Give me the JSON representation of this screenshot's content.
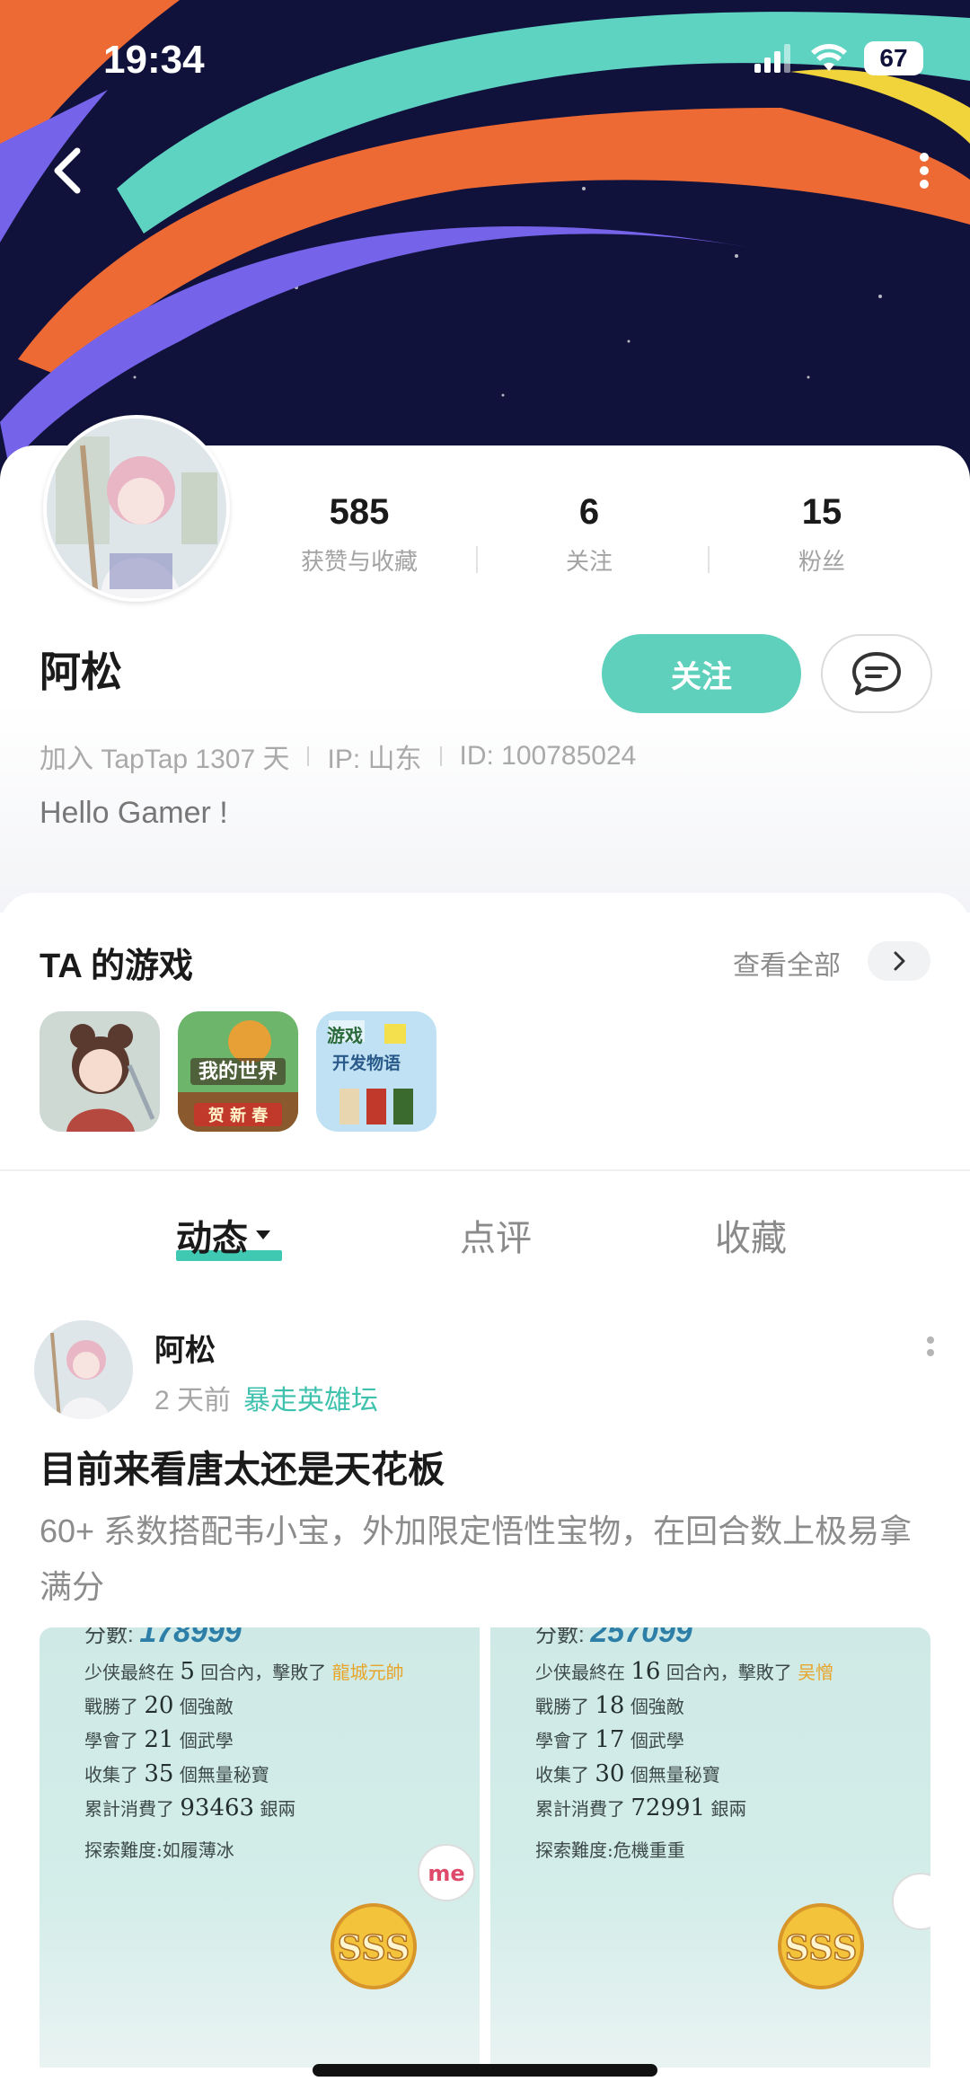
{
  "status_bar": {
    "time": "19:34",
    "battery": "67"
  },
  "profile": {
    "stats": [
      {
        "value": "585",
        "label": "获赞与收藏"
      },
      {
        "value": "6",
        "label": "关注"
      },
      {
        "value": "15",
        "label": "粉丝"
      }
    ],
    "name": "阿松",
    "follow_label": "关注",
    "meta": {
      "joined": "加入 TapTap 1307 天",
      "ip": "IP: 山东",
      "id": "ID: 100785024"
    },
    "bio": "Hello Gamer !"
  },
  "games": {
    "title": "TA 的游戏",
    "see_all": "查看全部",
    "items": [
      {
        "name": "game-1",
        "text": ""
      },
      {
        "name": "game-2",
        "text": "我的世界 贺新春"
      },
      {
        "name": "game-3",
        "text": "游戏 开发物语"
      }
    ]
  },
  "tabs": [
    {
      "label": "动态",
      "active": true
    },
    {
      "label": "点评",
      "active": false
    },
    {
      "label": "收藏",
      "active": false
    }
  ],
  "post": {
    "author": "阿松",
    "time": "2 天前",
    "forum": "暴走英雄坛",
    "title": "目前来看唐太还是天花板",
    "body": "60+ 系数搭配韦小宝，外加限定悟性宝物，在回合数上极易拿满分",
    "images": [
      {
        "score_label": "分數:",
        "score": "178999",
        "rounds": "5",
        "boss": "龍城元帥",
        "wins": "20",
        "skills": "21",
        "treasures": "35",
        "spent": "93463",
        "difficulty": "探索難度:如履薄冰",
        "grade": "SSS"
      },
      {
        "score_label": "分數:",
        "score": "257099",
        "rounds": "16",
        "boss": "吴憎",
        "wins": "18",
        "skills": "17",
        "treasures": "30",
        "spent": "72991",
        "difficulty": "探索難度:危機重重",
        "grade": "SSS"
      }
    ],
    "line_labels": {
      "rounds_pre": "少侠最終在",
      "rounds_post": "回合內，擊敗了",
      "wins_pre": "戰勝了",
      "wins_post": "個強敵",
      "skills_pre": "學會了",
      "skills_post": "個武學",
      "treasures_pre": "收集了",
      "treasures_post": "個無量秘寶",
      "spent_pre": "累計消費了",
      "spent_post": "銀兩"
    }
  },
  "colors": {
    "accent": "#5fd0bb",
    "banner_bg": "#10123b",
    "stripe_teal": "#5fd3c2",
    "stripe_orange": "#ee6a34",
    "stripe_purple": "#7563ea"
  }
}
